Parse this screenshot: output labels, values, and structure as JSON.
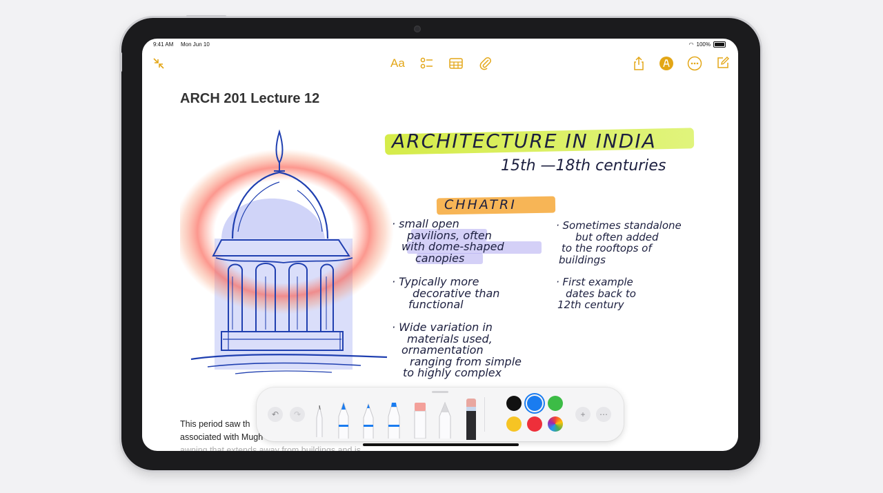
{
  "status_bar": {
    "time": "9:41 AM",
    "date": "Mon Jun 10",
    "battery": "100%"
  },
  "toolbar": {
    "format_label": "Aa"
  },
  "note": {
    "title": "ARCH 201 Lecture 12",
    "heading": "ARCHITECTURE IN INDIA",
    "subheading": "15th —18th centuries",
    "section": "CHHATRI",
    "left_bullets": [
      [
        "· small open",
        "pavilions, often",
        "with dome-shaped",
        "canopies"
      ],
      [
        "· Typically more",
        "decorative than",
        "functional"
      ],
      [
        "· Wide variation in",
        "materials used,",
        "ornamentation",
        "ranging from simple",
        "to highly complex"
      ]
    ],
    "right_bullets": [
      [
        "· Sometimes standalone",
        "but often added",
        "to the rooftops of",
        "buildings"
      ],
      [
        "· First example",
        "dates back to",
        "12th century"
      ]
    ],
    "typed_text": {
      "line1": "This period saw th",
      "line2": "associated with Mugh",
      "line3": "awning that extends away from buildings and is"
    }
  },
  "palette": {
    "colors": [
      "#111111",
      "#1a7cf0",
      "#3cbc46",
      "#f6c424",
      "#ee2f3a",
      "multicolor"
    ],
    "selected_color": "#1a7cf0"
  },
  "colors": {
    "accent": "#e3a616"
  }
}
